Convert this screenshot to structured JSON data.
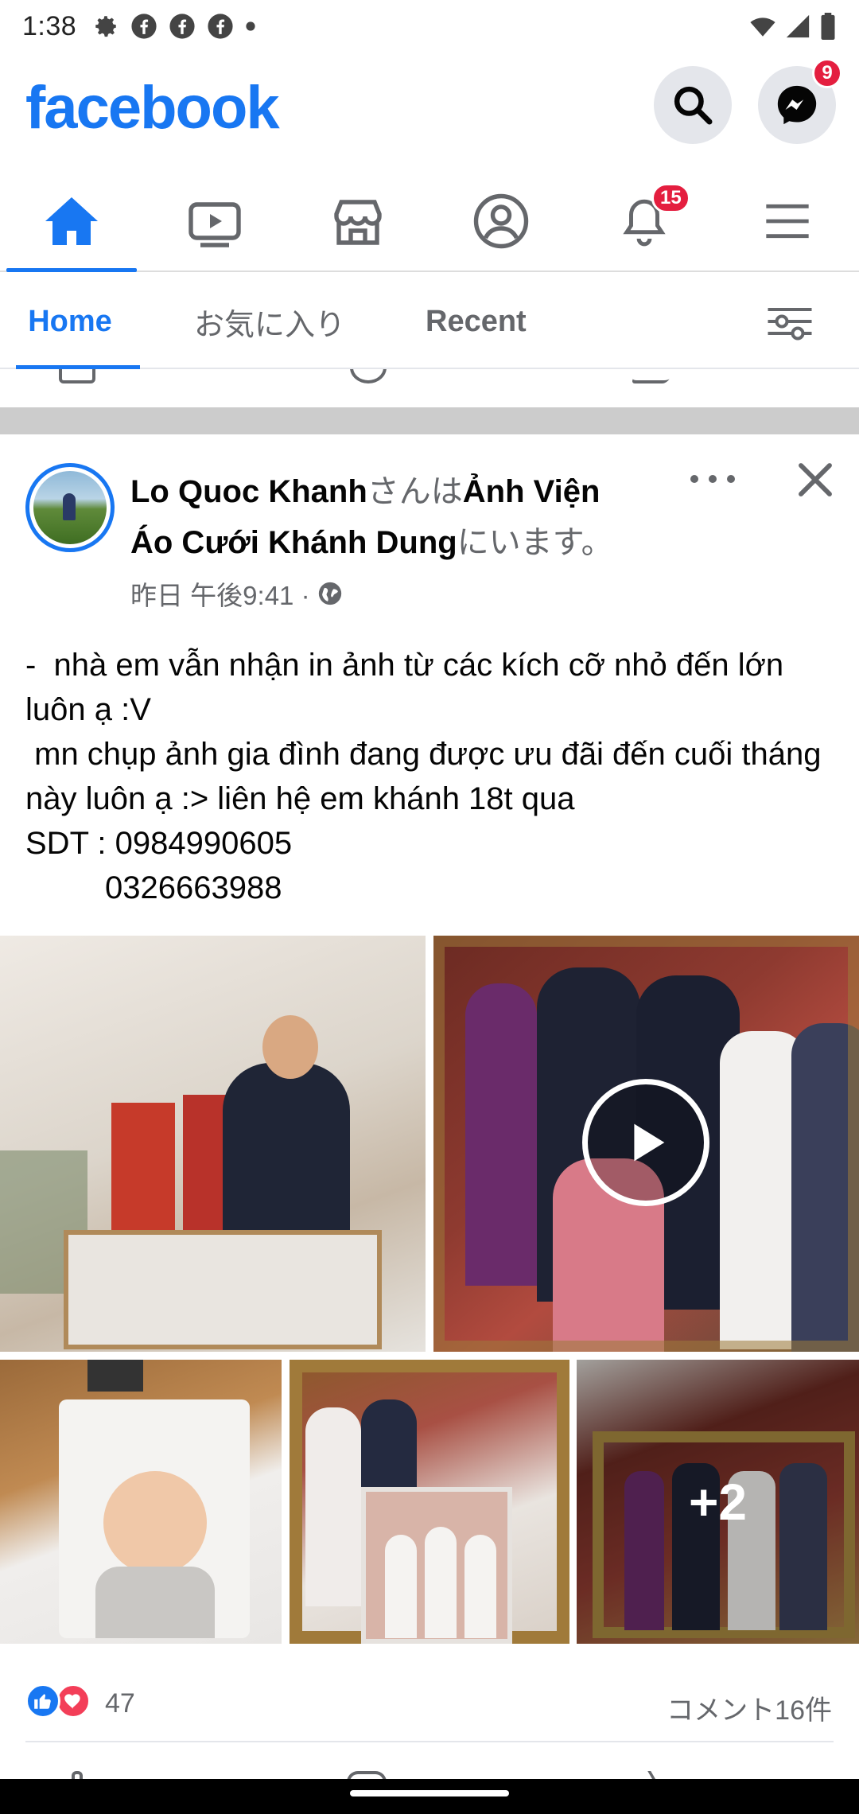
{
  "status_bar": {
    "time": "1:38"
  },
  "header": {
    "logo_text": "facebook",
    "messenger_badge": "9"
  },
  "nav_tabs": {
    "notifications_badge": "15"
  },
  "feed_tabs": {
    "home": "Home",
    "favorites": "お気に入り",
    "recent": "Recent"
  },
  "post": {
    "author": "Lo Quoc Khanh",
    "connector": "さんは",
    "place": "Ảnh Viện Áo Cưới Khánh Dung",
    "suffix": "にいます。",
    "time": "昨日 午後9:41 ·",
    "text": "-  nhà em vẫn nhận in ảnh từ các kích cỡ nhỏ đến lớn luôn ạ :V\n mn chụp ảnh gia đình đang được ưu đãi đến cuối tháng này luôn ạ :> liên hệ em khánh 18t qua\nSDT : 0984990605\n         0326663988",
    "more_photos": "+2",
    "reaction_count": "47",
    "comment_count": "コメント16件"
  },
  "colors": {
    "brand": "#1877F2",
    "badge": "#E41E3F",
    "love": "#F33E58"
  }
}
